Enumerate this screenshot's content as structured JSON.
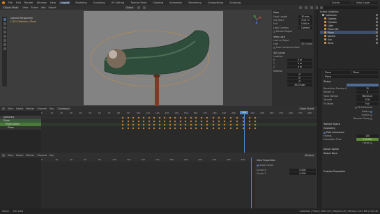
{
  "topbar": {
    "menus": [
      "File",
      "Edit",
      "Render",
      "Window",
      "Help"
    ],
    "tabs": [
      "Layout",
      "Modeling",
      "Sculpting",
      "UV Editing",
      "Texture Paint",
      "Shading",
      "Animation",
      "Rendering",
      "Compositing",
      "Scripting"
    ],
    "active_tab": "Layout",
    "scene": "Scene",
    "view_layer": "View Layer"
  },
  "viewport": {
    "mode": "Object Mode",
    "menus": [
      "View",
      "Select",
      "Add",
      "Object"
    ],
    "transform": "Global",
    "overlay_title": "Camera Perspective",
    "overlay_sub": "(110) Collection | Plane"
  },
  "n_panel": {
    "view_header": "View",
    "focal_length_label": "Focal Length",
    "focal_length": "50 mm",
    "clip_start_label": "Clip Start",
    "clip_start": "0.01 m",
    "end_label": "End",
    "end": "1000 m",
    "local_camera_label": "Local Camera",
    "local_camera": "Camera",
    "render_region": "Render Region",
    "view_lock_header": "View Lock",
    "lock_to_object": "Lock to Object",
    "lock_label": "Lock",
    "lock_cursor": "3D Cursor",
    "lock_camera": "Lock Camera to View",
    "cursor_header": "3D Cursor",
    "location_label": "Location",
    "x": "X",
    "x_val": "0 m",
    "y": "Y",
    "y_val": "0 m",
    "z": "Z",
    "z_val": "0 m",
    "rotation_label": "Rotation",
    "rx_val": "0°",
    "ry_val": "0°",
    "rz_val": "0°",
    "mode_label": "XYZ Euler"
  },
  "outliner": {
    "title": "Scene Collection",
    "items": [
      "Collection",
      "Camera",
      "Cylinder",
      "Light",
      "Plane.001",
      "Plane",
      "Sphere",
      "Sun",
      "Torus"
    ]
  },
  "properties": {
    "object_name": "Plane",
    "mesh_name": "Plane",
    "shape_header": "Shape",
    "resolution_preview_label": "Resolution Preview U",
    "resolution_preview": "12",
    "render_u_label": "Render U",
    "render_u": "0",
    "twist_method_label": "Twist Method",
    "twist_method": "Minimum",
    "smooth_label": "Smooth",
    "smooth": "0.00",
    "fill_mode_label": "Fill Mode",
    "fill_mode": "Full",
    "fill_deformed": "Fill Deformed",
    "radius": "Radius",
    "stretch": "Stretch",
    "bounds_clamp": "Bounds Clamp",
    "texture_space": "Texture Space",
    "geometry": "Geometry",
    "path_animation": "Path Animation",
    "frames_label": "Frames",
    "frames": "100",
    "eval_time_label": "Evaluation Time",
    "eval_time": "110.000",
    "follow": "Follow",
    "active_spline": "Active Spline",
    "shape_keys": "Shape Keys",
    "custom_props": "Custom Properties"
  },
  "dopesheet": {
    "menus": [
      "View",
      "Select",
      "Marker",
      "Channel",
      "Key"
    ],
    "mode": "Dope Sheet",
    "action_mode": "Summary",
    "channels": [
      "Summary",
      "Plane",
      "Plane Action",
      "Plane"
    ],
    "ticks": [
      "0",
      "10",
      "20",
      "30",
      "40",
      "50",
      "60",
      "70",
      "80",
      "90",
      "100",
      "110",
      "120",
      "130",
      "140",
      "150",
      "160",
      "170",
      "180",
      "190",
      "200",
      "210",
      "220",
      "230",
      "240",
      "250",
      "260",
      "270",
      "280"
    ],
    "current_frame": "110",
    "keyframes": [
      [
        175,
        "#e08f2d"
      ],
      [
        183,
        "#e08f2d"
      ],
      [
        190,
        "#e08f2d"
      ],
      [
        198,
        "#e08f2d"
      ],
      [
        205,
        "#e08f2d"
      ],
      [
        213,
        "#e08f2d"
      ],
      [
        220,
        "#e08f2d"
      ],
      [
        228,
        "#e08f2d"
      ],
      [
        235,
        "#e08f2d"
      ],
      [
        243,
        "#e08f2d"
      ],
      [
        250,
        "#e08f2d"
      ],
      [
        258,
        "#e08f2d"
      ],
      [
        265,
        "#e08f2d"
      ],
      [
        273,
        "#e08f2d"
      ],
      [
        280,
        "#e08f2d"
      ],
      [
        288,
        "#e08f2d"
      ],
      [
        296,
        "#e08f2d"
      ],
      [
        305,
        "#e08f2d"
      ],
      [
        313,
        "#e08f2d"
      ],
      [
        321,
        "#e08f2d"
      ],
      [
        330,
        "#e08f2d"
      ],
      [
        339,
        "#e08f2d"
      ],
      [
        348,
        "#e08f2d"
      ],
      [
        357,
        "#e08f2d"
      ],
      [
        365,
        "#e08f2d"
      ]
    ]
  },
  "graph": {
    "menus": [
      "View",
      "Select",
      "Marker",
      "Channel",
      "Key"
    ],
    "mode": "Drivers",
    "ticks": [
      "0",
      "20",
      "40",
      "60",
      "80",
      "100",
      "120",
      "140",
      "160",
      "180",
      "200",
      "220",
      "240",
      "260",
      "280"
    ],
    "view_props": "View Properties",
    "show_cursor": "Show Cursor",
    "cursor_x_label": "Cursor X",
    "cursor_x": "0.000",
    "cursor_y_label": "Cursor Y",
    "cursor_y": "0.000"
  },
  "status": {
    "left": "Select",
    "mid": "Pan View",
    "right": "Collection | Plane | Verts 0/0 | Objects 1/9 | Memory: 46.3 MB | 2.81.16"
  }
}
